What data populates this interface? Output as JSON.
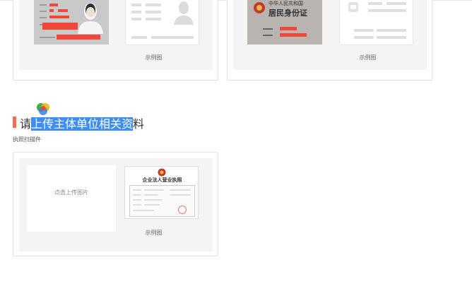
{
  "id_front_section": {
    "sample_caption": "示例图"
  },
  "id_back_section": {
    "sample_caption": "示例图",
    "card_title": "居民身份证",
    "card_heading": "中华人民共和国"
  },
  "business_section": {
    "title_prefix": "请",
    "title_highlight": "上传主体单位相关资",
    "title_suffix": "料",
    "sub_label": "执照扫描件",
    "upload_placeholder": "点击上传图片",
    "sample_caption": "示例图",
    "license_title": "企业法人营业执照"
  },
  "colors": {
    "accent_bar": "#f56f4f",
    "selection_highlight": "#3d8ef0",
    "redaction": "#f0473a"
  }
}
